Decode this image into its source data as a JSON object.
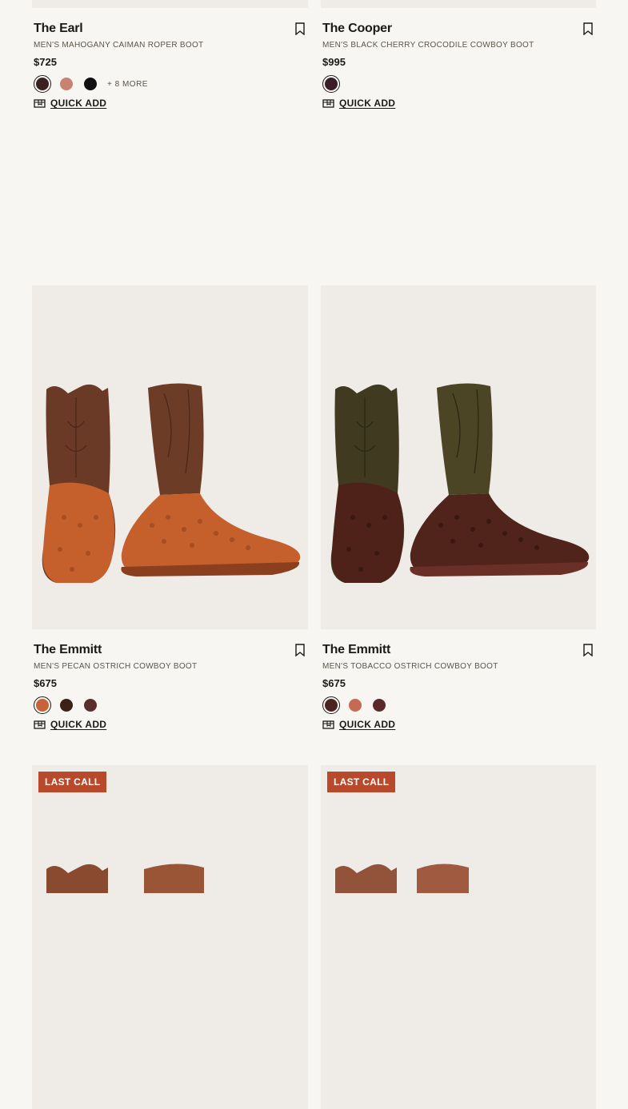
{
  "products": [
    {
      "name": "The Earl",
      "subtitle": "MEN'S MAHOGANY CAIMAN ROPER BOOT",
      "price": "$725",
      "more_colors": "+ 8 MORE",
      "swatches": [
        "#3b2020",
        "#c98370",
        "#111111"
      ],
      "quick_add": "QUICK ADD",
      "gallery_active": 1,
      "gallery_total": 7
    },
    {
      "name": "The Cooper",
      "subtitle": "MEN'S BLACK CHERRY CROCODILE COWBOY BOOT",
      "price": "$995",
      "swatches": [
        "#3a1d28"
      ],
      "quick_add": "QUICK ADD",
      "gallery_active": 1,
      "gallery_total": 10
    },
    {
      "name": "The Emmitt",
      "subtitle": "MEN'S PECAN OSTRICH COWBOY BOOT",
      "price": "$675",
      "swatches": [
        "#c7623a",
        "#3b2118",
        "#5a2e2a"
      ],
      "quick_add": "QUICK ADD",
      "gallery_active": 1,
      "gallery_total": 9
    },
    {
      "name": "The Emmitt",
      "subtitle": "MEN'S TOBACCO OSTRICH COWBOY BOOT",
      "price": "$675",
      "swatches": [
        "#4a241d",
        "#c46a55",
        "#5a2a2a"
      ],
      "quick_add": "QUICK ADD",
      "gallery_active": 1,
      "gallery_total": 8
    }
  ],
  "row3": [
    {
      "badge": "LAST CALL"
    },
    {
      "badge": "LAST CALL"
    }
  ],
  "colors": {
    "background": "#f8f6f2",
    "image_bg": "#efece7",
    "badge": "#b8492a",
    "progress_active": "#b6a584"
  },
  "icons": {
    "bookmark": "bookmark-icon",
    "quick_add": "shipping-box-icon"
  }
}
